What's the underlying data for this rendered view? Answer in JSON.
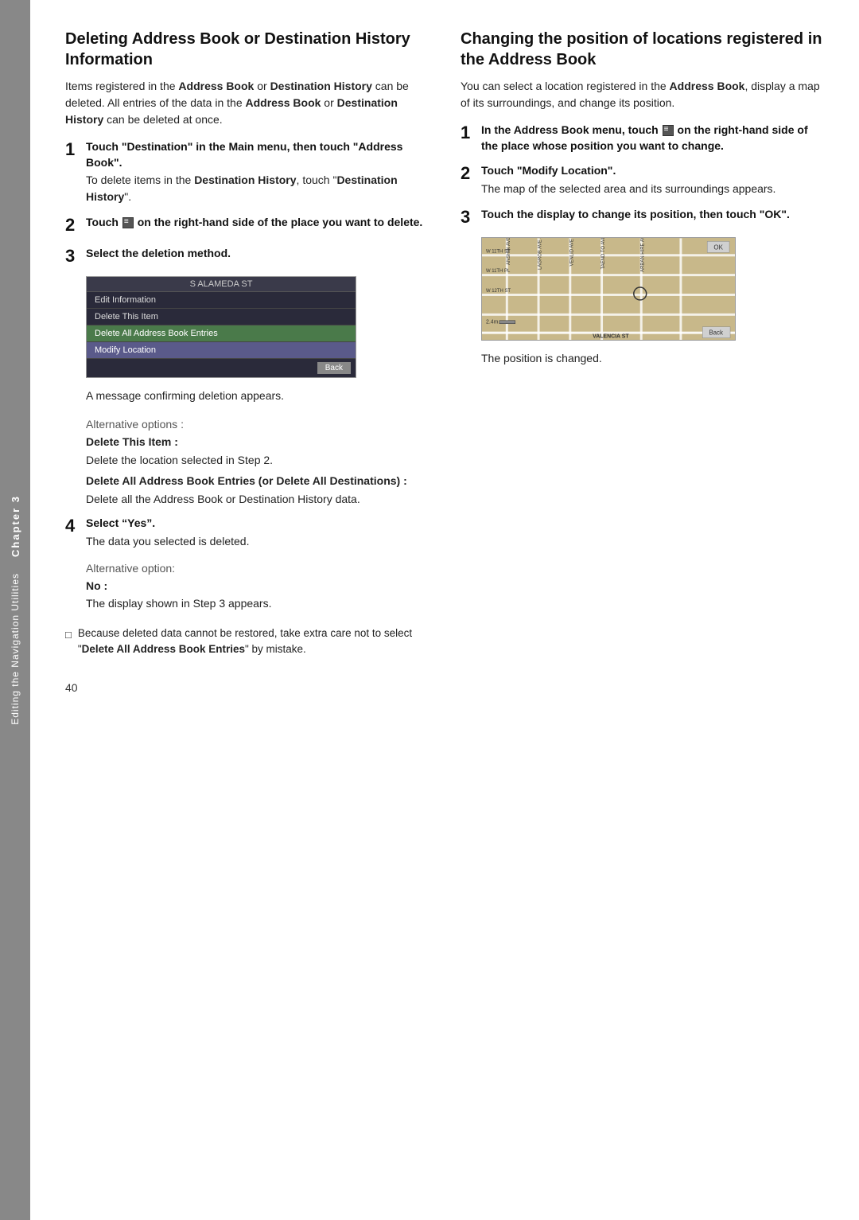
{
  "sidebar": {
    "chapter_label": "Chapter 3",
    "chapter_number": "3",
    "subtitle": "Editing the Navigation Utilities"
  },
  "left_section": {
    "title": "Deleting Address Book or Destination History Information",
    "intro": "Items registered in the Address Book or Destination History can be deleted. All entries of the data in the Address Book or Destination History can be deleted at once.",
    "steps": [
      {
        "number": "1",
        "title": "Touch “Destination” in the Main menu, then touch “Address Book”.",
        "body": "To delete items in the Destination History, touch “Destination History”."
      },
      {
        "number": "2",
        "title": "Touch ≡ on the right-hand side of the place you want to delete.",
        "body": ""
      },
      {
        "number": "3",
        "title": "Select the deletion method.",
        "body": ""
      }
    ],
    "screenshot": {
      "header": "S ALAMEDA ST",
      "items": [
        {
          "label": "Edit Information",
          "style": "normal"
        },
        {
          "label": "Delete This Item",
          "style": "normal"
        },
        {
          "label": "Delete All Address Book Entries",
          "style": "highlighted"
        },
        {
          "label": "Modify Location",
          "style": "highlighted2"
        }
      ],
      "back_button": "Back"
    },
    "screenshot_caption": "A message confirming deletion appears.",
    "alt_section": {
      "label": "Alternative options :",
      "option1_title": "Delete This Item :",
      "option1_body": "Delete the location selected in Step 2.",
      "option2_title": "Delete All Address Book Entries (or Delete All Destinations) :",
      "option2_body": "Delete all the Address Book or Destination History data."
    },
    "step4": {
      "number": "4",
      "title": "Select “Yes”.",
      "body": "The data you selected is deleted."
    },
    "alt_section2": {
      "label": "Alternative option:",
      "option_title": "No :",
      "option_body": "The display shown in Step 3 appears."
    },
    "note": "Because deleted data cannot be restored, take extra care not to select “Delete All Address Book Entries” by mistake."
  },
  "right_section": {
    "title": "Changing the position of locations registered in the Address Book",
    "intro": "You can select a location registered in the Address Book, display a map of its surroundings, and change its position.",
    "steps": [
      {
        "number": "1",
        "title": "In the Address Book menu, touch ≡ on the right-hand side of the place whose position you want to change.",
        "body": ""
      },
      {
        "number": "2",
        "title": "Touch “Modify Location”.",
        "body": "The map of the selected area and its surroundings appears."
      },
      {
        "number": "3",
        "title": "Touch the display to change its position, then touch “OK”.",
        "body": ""
      }
    ],
    "map_caption": "The position is changed.",
    "map_labels": {
      "ok": "OK",
      "back": "Back",
      "scale": "2.4m"
    }
  },
  "page_number": "40"
}
